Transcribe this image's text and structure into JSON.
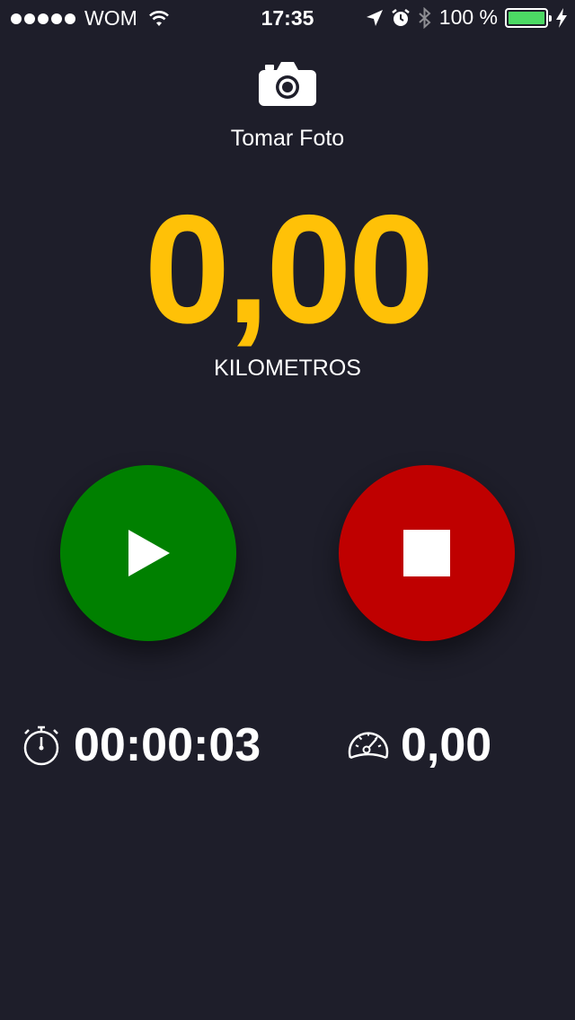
{
  "status_bar": {
    "carrier": "WOM",
    "time": "17:35",
    "battery": "100 %",
    "battery_level": 1.0,
    "icons": [
      "signal-dots-icon",
      "wifi-icon",
      "location-arrow-icon",
      "alarm-icon",
      "bluetooth-icon",
      "battery-icon",
      "charging-bolt-icon"
    ]
  },
  "camera": {
    "label": "Tomar Foto",
    "icon": "camera-icon"
  },
  "distance": {
    "value": "0,00",
    "unit": "KILOMETROS",
    "color": "#ffc107"
  },
  "controls": {
    "play": {
      "icon": "play-icon",
      "color": "#008000"
    },
    "stop": {
      "icon": "stop-icon",
      "color": "#bf0000"
    }
  },
  "stats": {
    "elapsed_time": "00:00:03",
    "elapsed_icon": "stopwatch-icon",
    "speed": "0,00",
    "speed_icon": "speedometer-icon"
  },
  "colors": {
    "background": "#1e1e2a"
  }
}
